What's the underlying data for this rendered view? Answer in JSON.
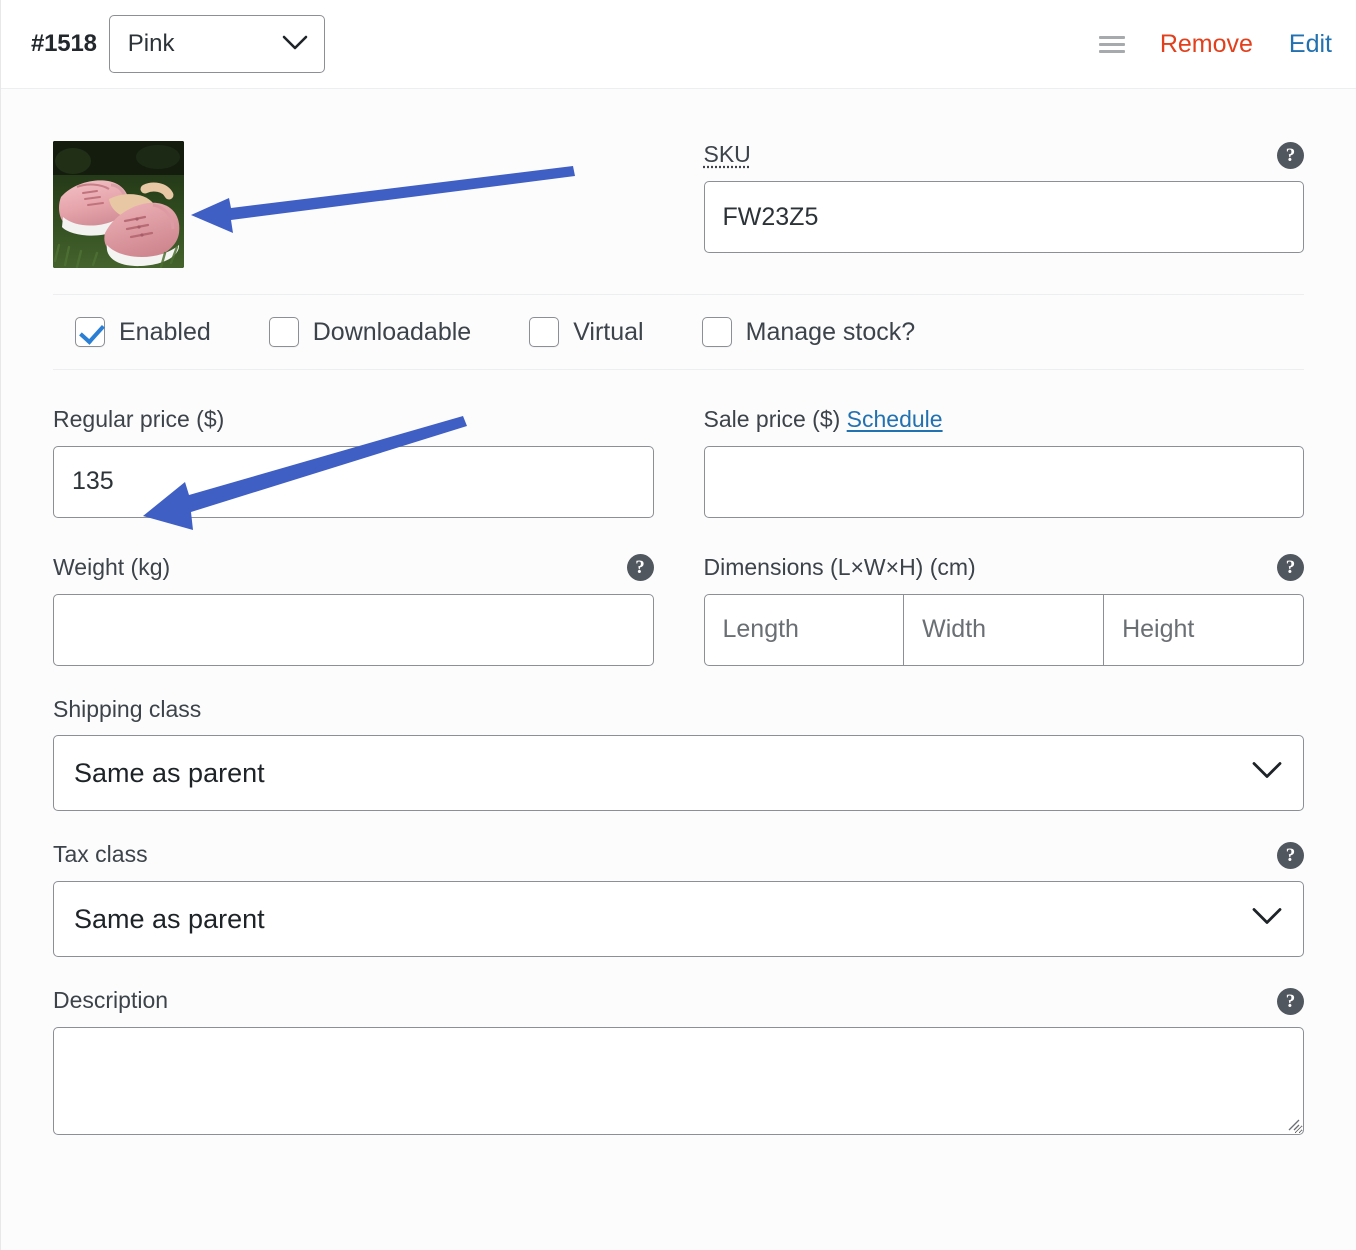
{
  "header": {
    "variation_id": "#1518",
    "attribute_value": "Pink",
    "drag_handle_icon": "hamburger-drag-icon",
    "remove_label": "Remove",
    "edit_label": "Edit",
    "chevron_icon": "chevron-down-icon"
  },
  "media": {
    "thumbnail_alt": "pink sneakers on grass"
  },
  "sku": {
    "label": "SKU",
    "value": "FW23Z5",
    "help_icon": "help-icon"
  },
  "checkboxes": [
    {
      "label": "Enabled",
      "checked": true
    },
    {
      "label": "Downloadable",
      "checked": false
    },
    {
      "label": "Virtual",
      "checked": false
    },
    {
      "label": "Manage stock?",
      "checked": false
    }
  ],
  "pricing": {
    "regular_label": "Regular price ($)",
    "regular_value": "135",
    "sale_label": "Sale price ($)",
    "sale_schedule_label": "Schedule",
    "sale_value": ""
  },
  "shipping": {
    "weight_label": "Weight (kg)",
    "weight_value": "",
    "weight_help_icon": "help-icon",
    "dimensions_label": "Dimensions (L×W×H) (cm)",
    "dimensions_help_icon": "help-icon",
    "length_placeholder": "Length",
    "width_placeholder": "Width",
    "height_placeholder": "Height",
    "length_value": "",
    "width_value": "",
    "height_value": "",
    "shipping_class_label": "Shipping class",
    "shipping_class_value": "Same as parent"
  },
  "tax": {
    "label": "Tax class",
    "value": "Same as parent",
    "help_icon": "help-icon"
  },
  "description": {
    "label": "Description",
    "value": "",
    "help_icon": "help-icon"
  },
  "annotations": {
    "arrow_color": "#3f5fc4",
    "arrow_1_target": "variation-thumbnail",
    "arrow_2_target": "regular-price-input"
  },
  "colors": {
    "remove_link": "#e2401c",
    "edit_link": "#2271b1",
    "schedule_link": "#2271b1",
    "checkbox_check": "#2a7fd4",
    "help_bubble": "#50575e",
    "border": "#8c8f94"
  }
}
